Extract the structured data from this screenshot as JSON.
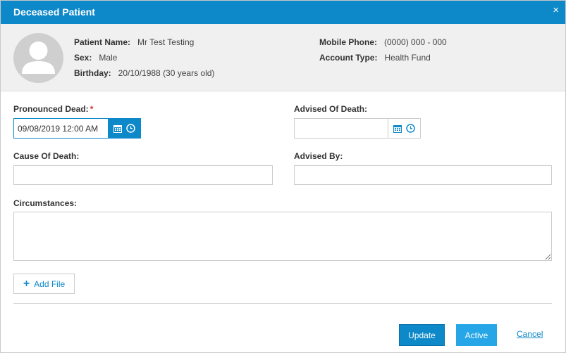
{
  "dialog": {
    "title": "Deceased Patient",
    "close_glyph": "×"
  },
  "patient": {
    "name_label": "Patient Name:",
    "name_value": "Mr Test Testing",
    "sex_label": "Sex:",
    "sex_value": "Male",
    "birthday_label": "Birthday:",
    "birthday_value": "20/10/1988 (30 years old)",
    "mobile_label": "Mobile Phone:",
    "mobile_value": "(0000) 000 - 000",
    "account_label": "Account Type:",
    "account_value": "Health Fund",
    "avatar_icon": "user-silhouette-icon"
  },
  "form": {
    "pronounced_dead_label": "Pronounced Dead:",
    "required_marker": "*",
    "pronounced_dead_value": "09/08/2019 12:00 AM",
    "advised_of_death_label": "Advised Of Death:",
    "advised_of_death_value": "",
    "cause_of_death_label": "Cause Of Death:",
    "cause_of_death_value": "",
    "advised_by_label": "Advised By:",
    "advised_by_value": "",
    "circumstances_label": "Circumstances:",
    "circumstances_value": ""
  },
  "actions": {
    "add_file_label": "Add File",
    "update_label": "Update",
    "active_label": "Active",
    "cancel_label": "Cancel"
  },
  "colors": {
    "primary": "#0d88c9",
    "active_button": "#26a6e6",
    "required": "#d9302b",
    "panel_background": "#f0f0f0"
  }
}
